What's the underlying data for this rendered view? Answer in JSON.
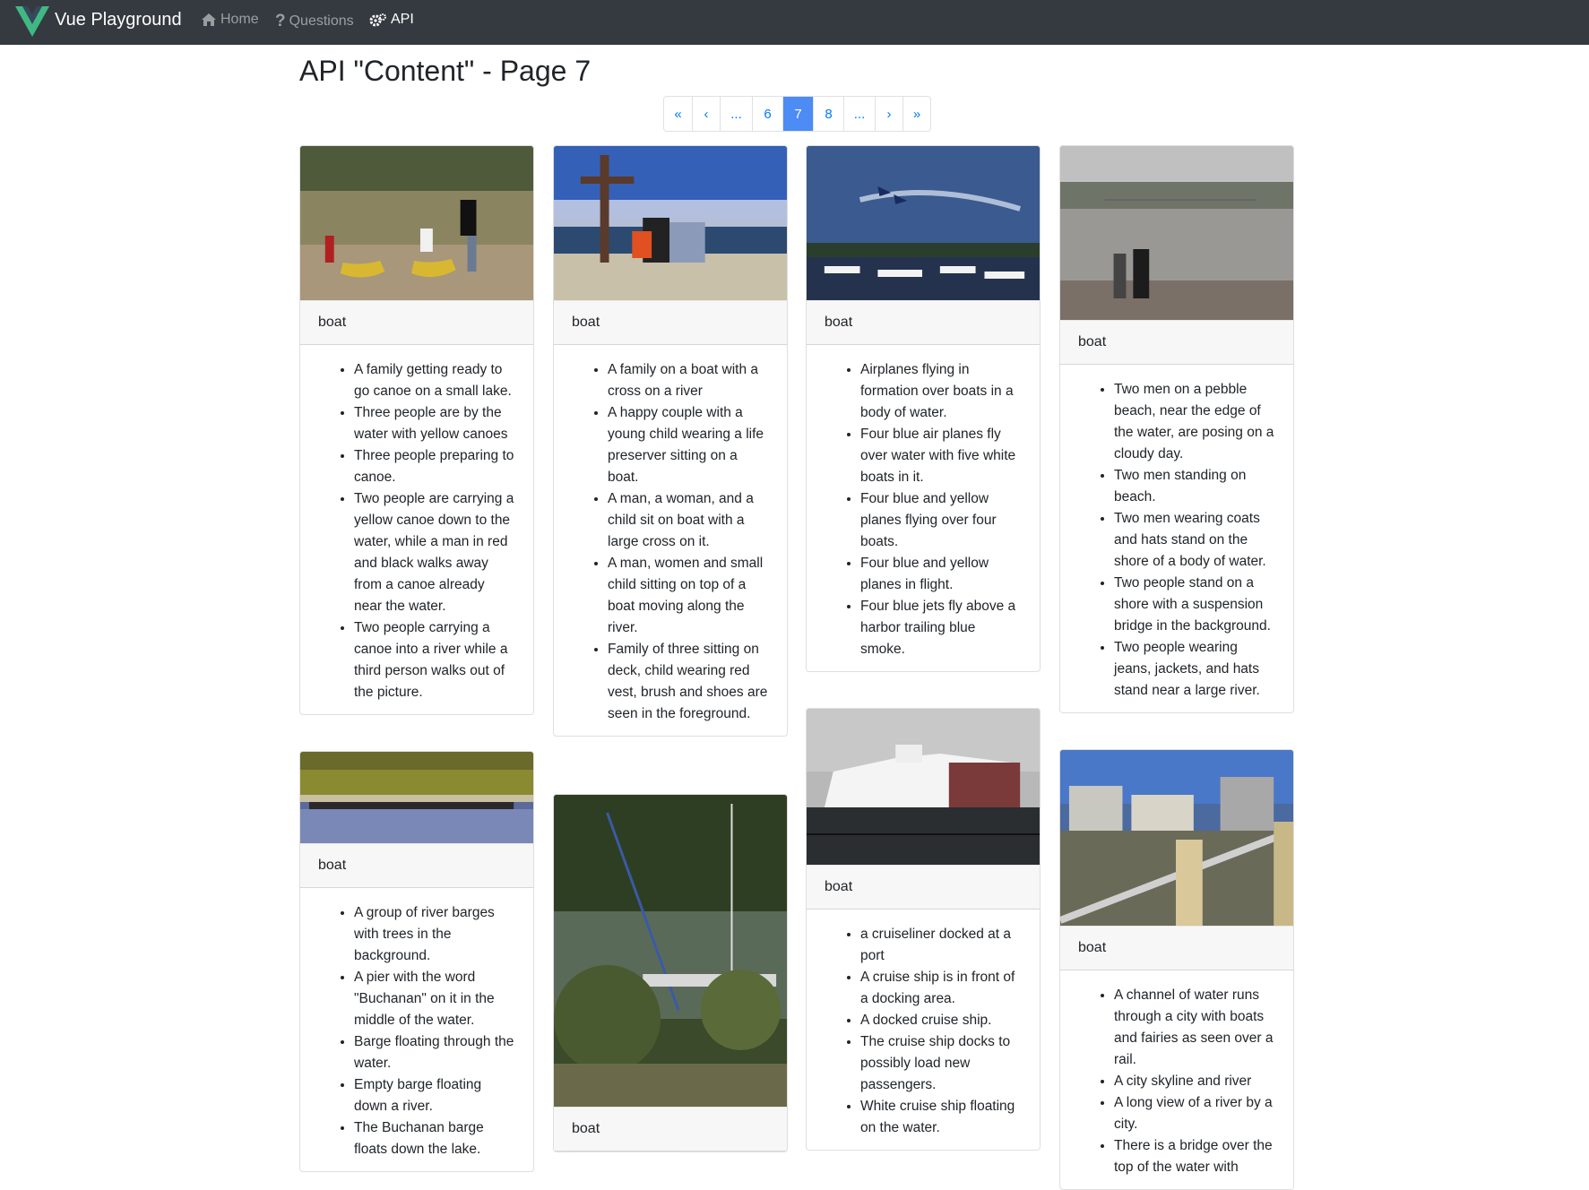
{
  "navbar": {
    "brand": "Vue Playground",
    "links": [
      {
        "label": "Home",
        "icon": "home-icon",
        "active": false
      },
      {
        "label": "Questions",
        "icon": "question-icon",
        "active": false
      },
      {
        "label": "API",
        "icon": "cogs-icon",
        "active": true
      }
    ]
  },
  "page": {
    "title": "API \"Content\" - Page 7"
  },
  "pagination": {
    "items": [
      {
        "label": "«",
        "name": "first-page-button"
      },
      {
        "label": "‹",
        "name": "prev-page-button"
      },
      {
        "label": "...",
        "name": "ellipsis-left"
      },
      {
        "label": "6",
        "name": "page-6-button"
      },
      {
        "label": "7",
        "name": "page-7-button",
        "active": true
      },
      {
        "label": "8",
        "name": "page-8-button"
      },
      {
        "label": "...",
        "name": "ellipsis-right"
      },
      {
        "label": "›",
        "name": "next-page-button"
      },
      {
        "label": "»",
        "name": "last-page-button"
      }
    ]
  },
  "cards": [
    {
      "header": "boat",
      "image": "family-canoe-photo",
      "captions": [
        "A family getting ready to go canoe on a small lake.",
        "Three people are by the water with yellow canoes",
        "Three people preparing to canoe.",
        "Two people are carrying a yellow canoe down to the water, while a man in red and black walks away from a canoe already near the water.",
        "Two people carrying a canoe into a river while a third person walks out of the picture."
      ]
    },
    {
      "header": "boat",
      "image": "family-boat-cross-photo",
      "captions": [
        "A family on a boat with a cross on a river",
        "A happy couple with a young child wearing a life preserver sitting on a boat.",
        "A man, a woman, and a child sit on boat with a large cross on it.",
        "A man, women and small child sitting on top of a boat moving along the river.",
        "Family of three sitting on deck, child wearing red vest, brush and shoes are seen in the foreground."
      ]
    },
    {
      "header": "boat",
      "image": "airplanes-harbor-photo",
      "captions": [
        "Airplanes flying in formation over boats in a body of water.",
        "Four blue air planes fly over water with five white boats in it.",
        "Four blue and yellow planes flying over four boats.",
        "Four blue and yellow planes in flight.",
        "Four blue jets fly above a harbor trailing blue smoke."
      ]
    },
    {
      "header": "boat",
      "image": "two-men-beach-photo",
      "captions": [
        "Two men on a pebble beach, near the edge of the water, are posing on a cloudy day.",
        "Two men standing on beach.",
        "Two men wearing coats and hats stand on the shore of a body of water.",
        "Two people stand on a shore with a suspension bridge in the background.",
        "Two people wearing jeans, jackets, and hats stand near a large river."
      ]
    },
    {
      "header": "boat",
      "image": "river-barge-photo",
      "captions": [
        "A group of river barges with trees in the background.",
        "A pier with the word \"Buchanan\" on it in the middle of the water.",
        "Barge floating through the water.",
        "Empty barge floating down a river.",
        "The Buchanan barge floats down the lake."
      ]
    },
    {
      "header": "boat",
      "image": "marina-trees-photo",
      "captions": []
    },
    {
      "header": "boat",
      "image": "cruise-ship-photo",
      "captions": [
        "a cruiseliner docked at a port",
        "A cruise ship is in front of a docking area.",
        "A docked cruise ship.",
        "The cruise ship docks to possibly load new passengers.",
        "White cruise ship floating on the water."
      ]
    },
    {
      "header": "boat",
      "image": "city-river-rail-photo",
      "captions": [
        "A channel of water runs through a city with boats and fairies as seen over a rail.",
        "A city skyline and river",
        "A long view of a river by a city.",
        "There is a bridge over the top of the water with"
      ]
    }
  ]
}
